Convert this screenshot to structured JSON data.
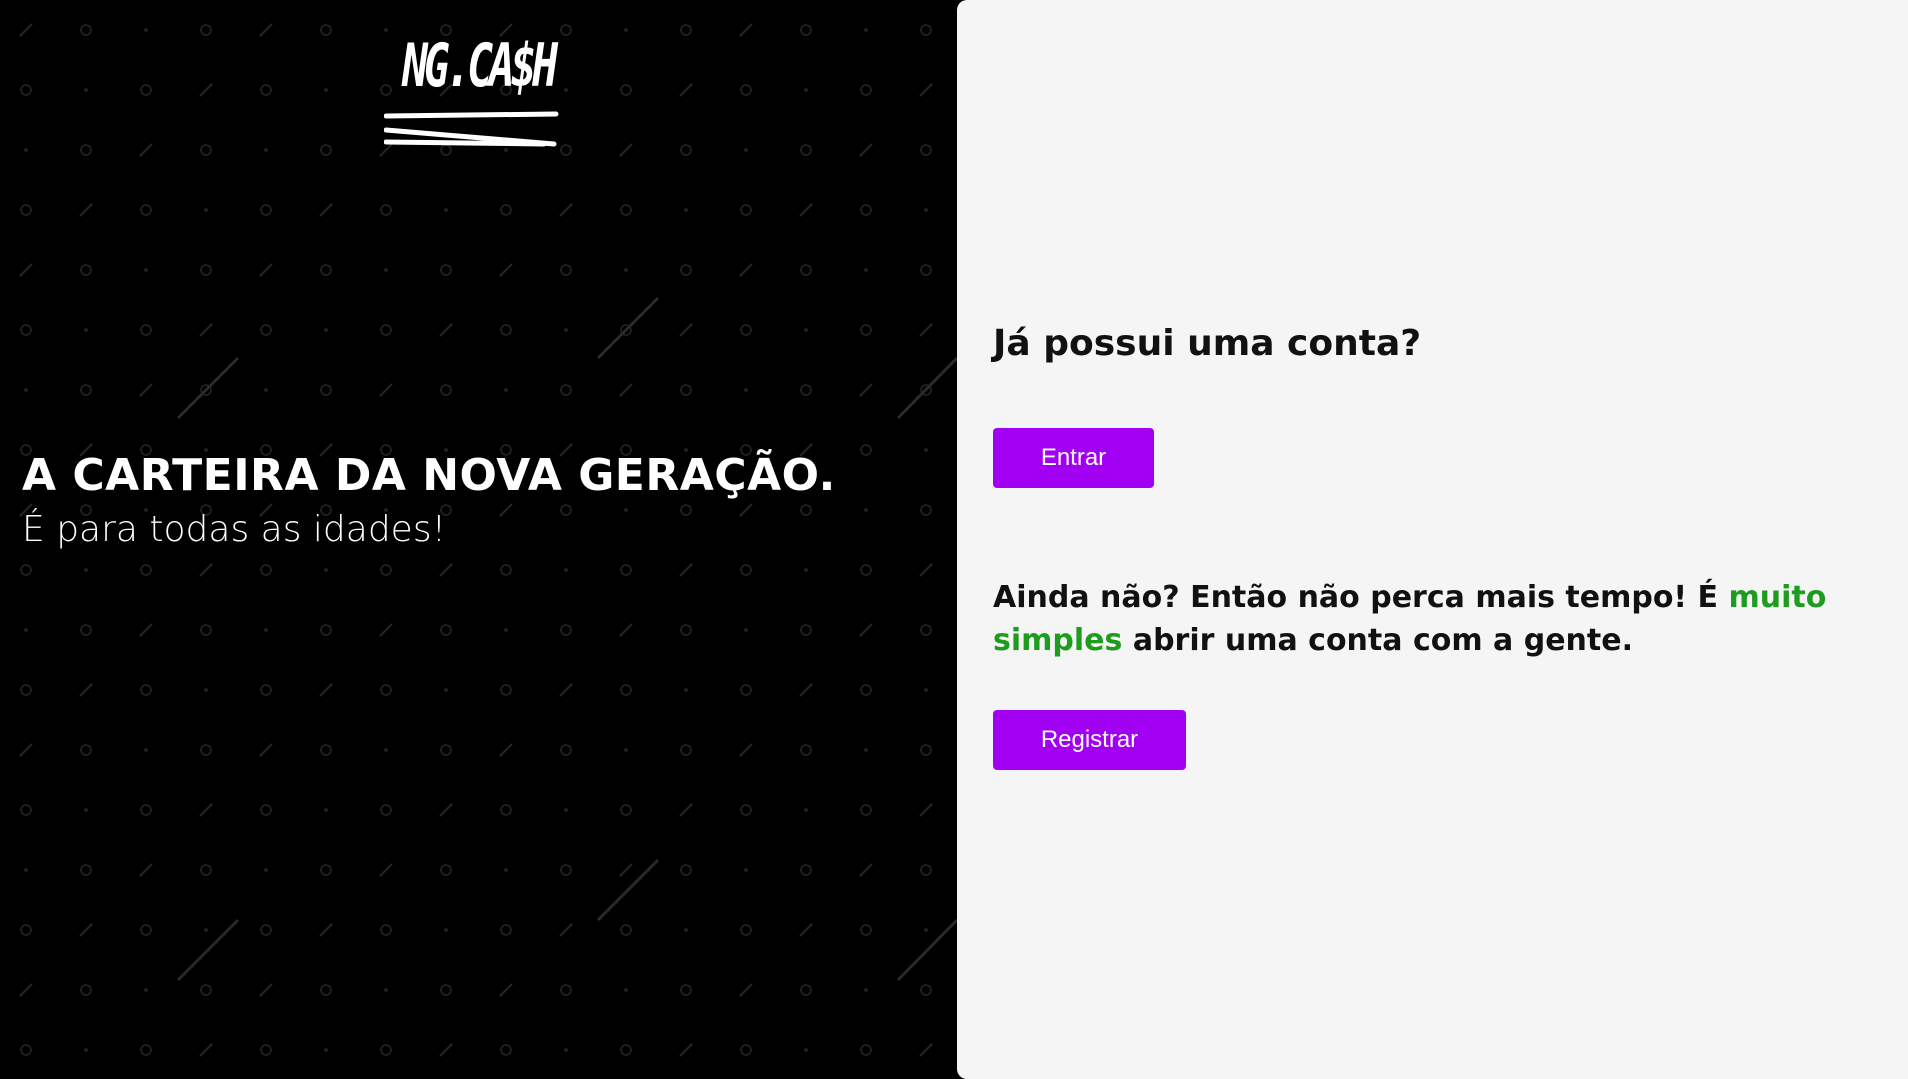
{
  "brand": {
    "logo_text": "NG.CA$H"
  },
  "hero": {
    "title": "A CARTEIRA DA NOVA GERAÇÃO.",
    "subtitle": "É para todas as idades!"
  },
  "auth": {
    "login_heading": "Já possui uma conta?",
    "login_button": "Entrar",
    "register_text_before": "Ainda não? Então não perca mais tempo! É ",
    "register_text_highlight": "muito simples",
    "register_text_after": " abrir uma conta com a gente.",
    "register_button": "Registrar"
  },
  "colors": {
    "accent": "#a100f2",
    "highlight": "#1e9c1e",
    "left_background": "#000000",
    "right_background": "#f5f5f5"
  }
}
